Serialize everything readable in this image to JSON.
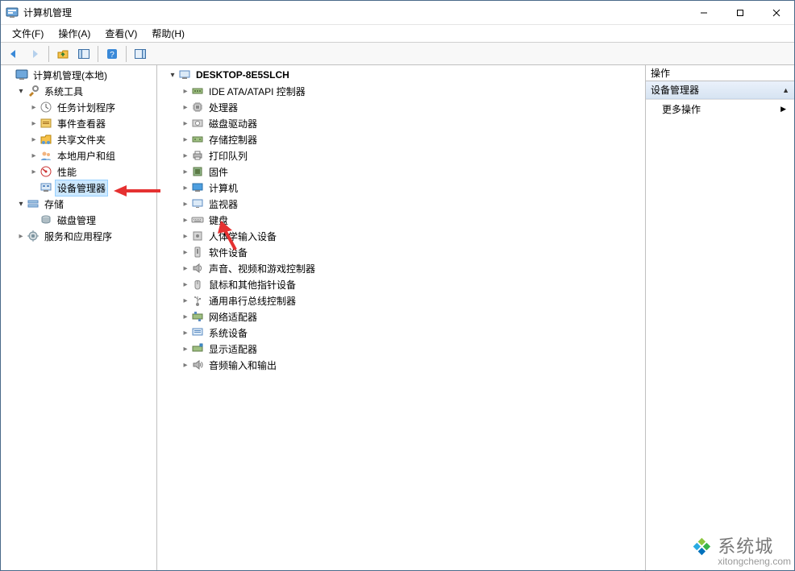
{
  "window": {
    "title": "计算机管理"
  },
  "menubar": {
    "file": "文件(F)",
    "action": "操作(A)",
    "view": "查看(V)",
    "help": "帮助(H)"
  },
  "left_tree": {
    "root": "计算机管理(本地)",
    "system_tools": "系统工具",
    "task_scheduler": "任务计划程序",
    "event_viewer": "事件查看器",
    "shared_folders": "共享文件夹",
    "local_users": "本地用户和组",
    "performance": "性能",
    "device_manager": "设备管理器",
    "storage": "存储",
    "disk_management": "磁盘管理",
    "services_apps": "服务和应用程序"
  },
  "device_tree": {
    "root": "DESKTOP-8E5SLCH",
    "ide": "IDE ATA/ATAPI 控制器",
    "cpu": "处理器",
    "diskdrv": "磁盘驱动器",
    "storage": "存储控制器",
    "printq": "打印队列",
    "firmware": "固件",
    "computer": "计算机",
    "monitor": "监视器",
    "keyboard": "键盘",
    "hid": "人体学输入设备",
    "software": "软件设备",
    "sound": "声音、视频和游戏控制器",
    "mouse": "鼠标和其他指针设备",
    "usb": "通用串行总线控制器",
    "network": "网络适配器",
    "system": "系统设备",
    "display": "显示适配器",
    "audio": "音频输入和输出"
  },
  "actions": {
    "header": "操作",
    "section_title": "设备管理器",
    "more_actions": "更多操作"
  },
  "watermark": {
    "cn": "系统城",
    "en": "xitongcheng.com"
  }
}
